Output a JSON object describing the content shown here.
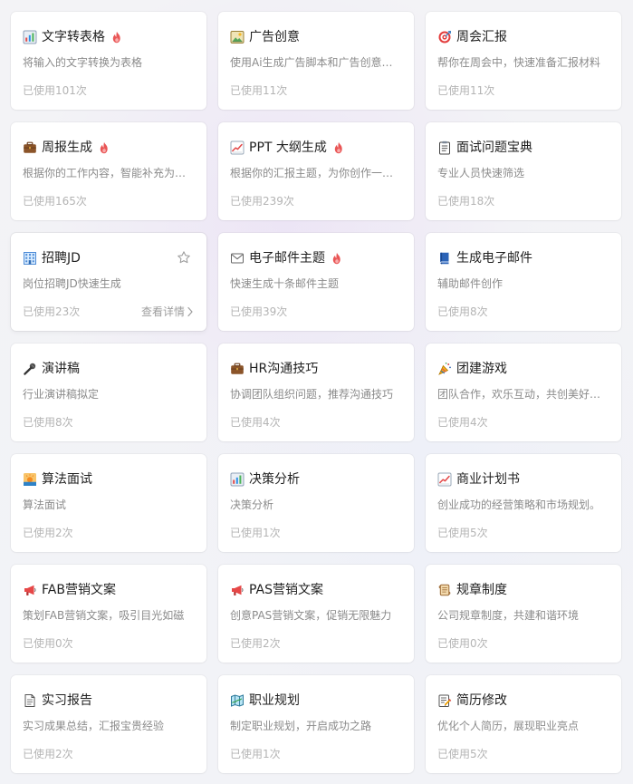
{
  "cards": [
    {
      "icon": "bar-chart-icon",
      "title": "文字转表格",
      "hot": true,
      "desc": "将输入的文字转换为表格",
      "usage": "已使用101次"
    },
    {
      "icon": "picture-icon",
      "title": "广告创意",
      "hot": false,
      "desc": "使用Ai生成广告脚本和广告创意想法",
      "usage": "已使用11次"
    },
    {
      "icon": "target-icon",
      "title": "周会汇报",
      "hot": false,
      "desc": "帮你在周会中，快速准备汇报材料",
      "usage": "已使用11次"
    },
    {
      "icon": "briefcase-icon",
      "title": "周报生成",
      "hot": true,
      "desc": "根据你的工作内容，智能补充为完…",
      "usage": "已使用165次"
    },
    {
      "icon": "trend-chart-icon",
      "title": "PPT 大纲生成",
      "hot": true,
      "desc": "根据你的汇报主题，为你创作一份…",
      "usage": "已使用239次"
    },
    {
      "icon": "clipboard-icon",
      "title": "面试问题宝典",
      "hot": false,
      "desc": "专业人员快速筛选",
      "usage": "已使用18次"
    },
    {
      "icon": "building-icon",
      "title": "招聘JD",
      "hot": false,
      "desc": "岗位招聘JD快速生成",
      "usage": "已使用23次",
      "detail": "查看详情",
      "star": true,
      "active": true
    },
    {
      "icon": "envelope-icon",
      "title": "电子邮件主题",
      "hot": true,
      "desc": "快速生成十条邮件主题",
      "usage": "已使用39次"
    },
    {
      "icon": "book-icon",
      "title": "生成电子邮件",
      "hot": false,
      "desc": "辅助邮件创作",
      "usage": "已使用8次"
    },
    {
      "icon": "microphone-icon",
      "title": "演讲稿",
      "hot": false,
      "desc": "行业演讲稿拟定",
      "usage": "已使用8次"
    },
    {
      "icon": "briefcase-icon",
      "title": "HR沟通技巧",
      "hot": false,
      "desc": "协调团队组织问题，推荐沟通技巧",
      "usage": "已使用4次"
    },
    {
      "icon": "party-popper-icon",
      "title": "团建游戏",
      "hot": false,
      "desc": "团队合作，欢乐互动，共创美好回…",
      "usage": "已使用4次"
    },
    {
      "icon": "sunrise-icon",
      "title": "算法面试",
      "hot": false,
      "desc": "算法面试",
      "usage": "已使用2次"
    },
    {
      "icon": "bar-chart-icon",
      "title": "决策分析",
      "hot": false,
      "desc": "决策分析",
      "usage": "已使用1次"
    },
    {
      "icon": "trend-chart-icon",
      "title": "商业计划书",
      "hot": false,
      "desc": "创业成功的经营策略和市场规划。",
      "usage": "已使用5次"
    },
    {
      "icon": "megaphone-icon",
      "title": "FAB营销文案",
      "hot": false,
      "desc": "策划FAB营销文案，吸引目光如磁",
      "usage": "已使用0次"
    },
    {
      "icon": "megaphone-icon",
      "title": "PAS营销文案",
      "hot": false,
      "desc": "创意PAS营销文案，促销无限魅力",
      "usage": "已使用2次"
    },
    {
      "icon": "scroll-icon",
      "title": "规章制度",
      "hot": false,
      "desc": "公司规章制度，共建和谐环境",
      "usage": "已使用0次"
    },
    {
      "icon": "document-icon",
      "title": "实习报告",
      "hot": false,
      "desc": "实习成果总结，汇报宝贵经验",
      "usage": "已使用2次"
    },
    {
      "icon": "map-icon",
      "title": "职业规划",
      "hot": false,
      "desc": "制定职业规划，开启成功之路",
      "usage": "已使用1次"
    },
    {
      "icon": "memo-icon",
      "title": "简历修改",
      "hot": false,
      "desc": "优化个人简历，展现职业亮点",
      "usage": "已使用5次"
    }
  ]
}
